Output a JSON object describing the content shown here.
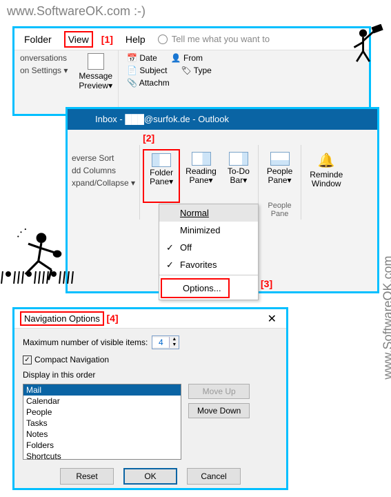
{
  "watermark": {
    "top": "www.SoftwareOK.com :-)",
    "right": "www.SoftwareOK.com"
  },
  "annotations": {
    "a1": "[1]",
    "a2": "[2]",
    "a3": "[3]",
    "a4": "[4]"
  },
  "win1": {
    "menu": {
      "folder": "Folder",
      "view": "View",
      "help": "Help",
      "tellme": "Tell me what you want to"
    },
    "left": {
      "conversations": "onversations",
      "settings": "on Settings ▾"
    },
    "msgpreview": "Message\nPreview▾",
    "arrange": {
      "date": "Date",
      "from": "From",
      "subject": "Subject",
      "type": "Type",
      "attach": "Attachm"
    }
  },
  "win2": {
    "title": "Inbox - ███@surfok.de - Outlook",
    "left": {
      "reverse": "everse Sort",
      "addcols": "dd Columns",
      "expand": "xpand/Collapse ▾"
    },
    "btns": {
      "folderpane": "Folder\nPane▾",
      "readingpane": "Reading\nPane▾",
      "todobar": "To-Do\nBar▾",
      "peoplepane": "People\nPane▾",
      "reminder": "Reminde\nWindow"
    },
    "group_people": "People Pane"
  },
  "dropdown": {
    "normal": "Normal",
    "minimized": "Minimized",
    "off": "Off",
    "favorites": "Favorites",
    "options": "Options..."
  },
  "dialog": {
    "title": "Navigation Options",
    "maxitems_label": "Maximum number of visible items:",
    "maxitems_value": "4",
    "compact": "Compact Navigation",
    "order_label": "Display in this order",
    "items": [
      "Mail",
      "Calendar",
      "People",
      "Tasks",
      "Notes",
      "Folders",
      "Shortcuts"
    ],
    "moveup": "Move Up",
    "movedown": "Move Down",
    "reset": "Reset",
    "ok": "OK",
    "cancel": "Cancel"
  }
}
